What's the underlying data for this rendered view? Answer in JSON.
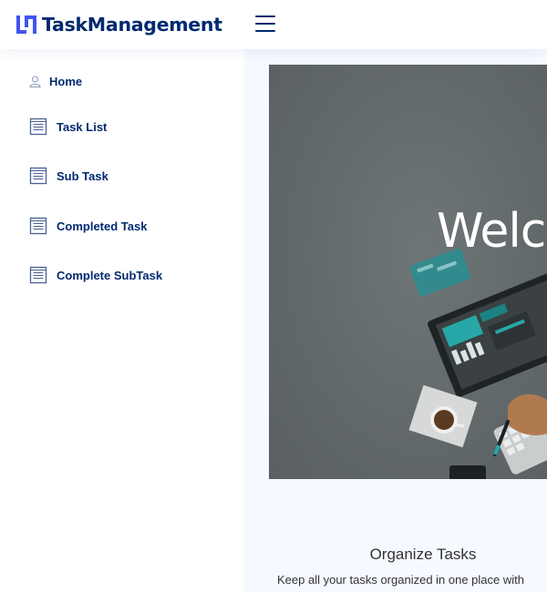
{
  "brand": {
    "name": "TaskManagement",
    "logo_icon": "logo-icon",
    "color": "#012970"
  },
  "header": {
    "menu_icon": "hamburger-menu-icon"
  },
  "sidebar": {
    "items": [
      {
        "label": "Home",
        "icon": "person-icon"
      },
      {
        "label": "Task List",
        "icon": "document-icon"
      },
      {
        "label": "Sub Task",
        "icon": "document-icon"
      },
      {
        "label": "Completed Task",
        "icon": "document-icon"
      },
      {
        "label": "Complete SubTask",
        "icon": "document-icon"
      }
    ]
  },
  "hero": {
    "title": "Welco"
  },
  "feature": {
    "title": "Organize Tasks",
    "description": "Keep all your tasks organized in one place with"
  }
}
